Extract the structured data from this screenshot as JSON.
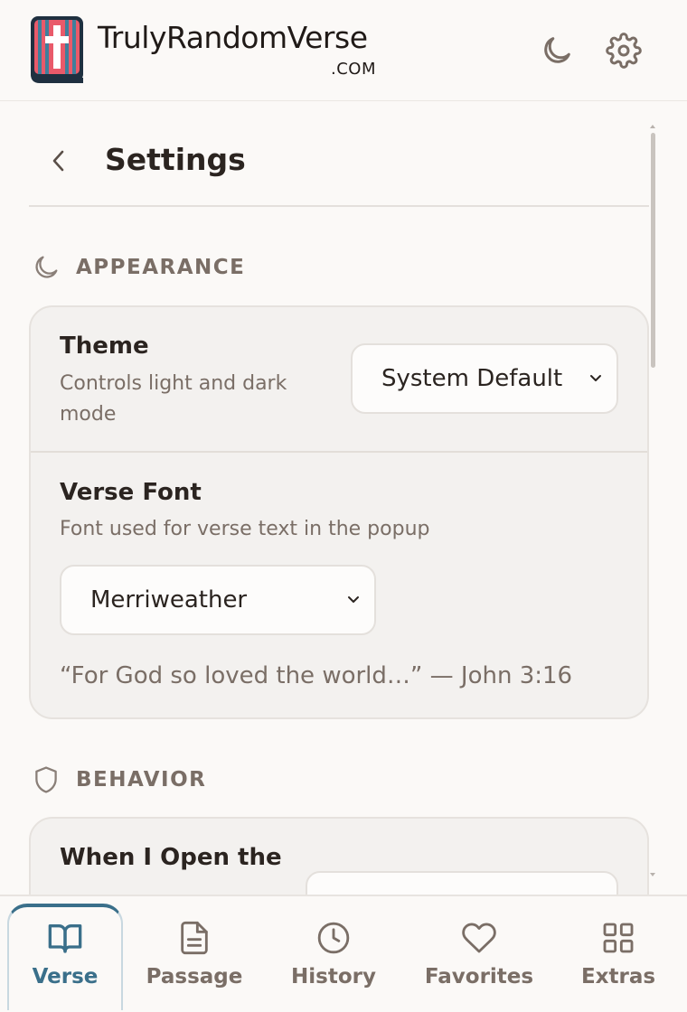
{
  "header": {
    "brand_name": "TrulyRandomVerse",
    "brand_tld": ".COM",
    "icons": {
      "theme_toggle": "moon-icon",
      "settings": "gear-icon"
    }
  },
  "settings": {
    "title": "Settings",
    "back_icon": "chevron-left-icon"
  },
  "appearance": {
    "label": "APPEARANCE",
    "icon": "moon-icon",
    "theme": {
      "title": "Theme",
      "description": "Controls light and dark mode",
      "selected": "System Default"
    },
    "verse_font": {
      "title": "Verse Font",
      "description": "Font used for verse text in the popup",
      "selected": "Merriweather",
      "preview": "“For God so loved the world…” — John 3:16"
    }
  },
  "behavior": {
    "label": "BEHAVIOR",
    "icon": "shield-icon",
    "open_title": "When I Open the"
  },
  "nav": {
    "items": [
      {
        "label": "Verse",
        "icon": "book-open-icon",
        "active": true
      },
      {
        "label": "Passage",
        "icon": "document-icon",
        "active": false
      },
      {
        "label": "History",
        "icon": "clock-icon",
        "active": false
      },
      {
        "label": "Favorites",
        "icon": "heart-icon",
        "active": false
      },
      {
        "label": "Extras",
        "icon": "grid-icon",
        "active": false
      }
    ]
  },
  "colors": {
    "accent": "#3a6f8a",
    "text": "#2b2420",
    "muted": "#7a6e66",
    "background": "#fbf9f7",
    "card": "#f3f1ef"
  }
}
